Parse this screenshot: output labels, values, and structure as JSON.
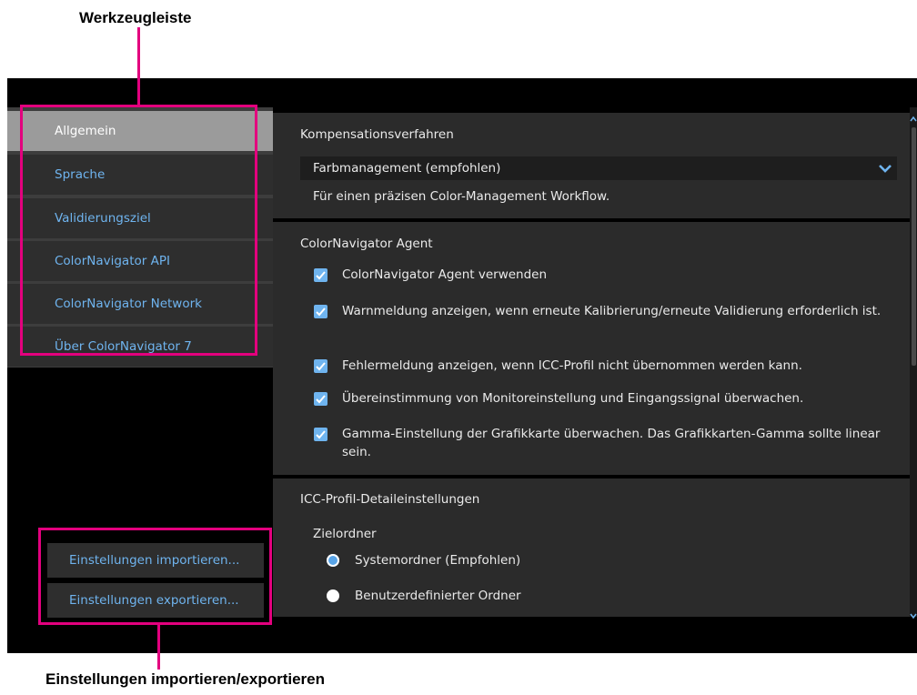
{
  "callouts": {
    "toolbar": "Werkzeugleiste",
    "import_export": "Einstellungen importieren/exportieren"
  },
  "sidebar": {
    "items": [
      {
        "label": "Allgemein",
        "active": true
      },
      {
        "label": "Sprache"
      },
      {
        "label": "Validierungsziel"
      },
      {
        "label": "ColorNavigator API"
      },
      {
        "label": "ColorNavigator Network"
      },
      {
        "label": "Über ColorNavigator 7"
      }
    ],
    "import_label": "Einstellungen importieren...",
    "export_label": "Einstellungen exportieren..."
  },
  "compensation": {
    "title": "Kompensationsverfahren",
    "selected": "Farbmanagement (empfohlen)",
    "description": "Für einen präzisen Color-Management Workflow."
  },
  "agent": {
    "title": "ColorNavigator Agent",
    "options": [
      {
        "label": "ColorNavigator Agent verwenden",
        "checked": true
      },
      {
        "label": "Warnmeldung anzeigen, wenn erneute Kalibrierung/erneute Validierung erforderlich ist.",
        "checked": true
      },
      {
        "label": "Fehlermeldung anzeigen, wenn ICC-Profil nicht übernommen werden kann.",
        "checked": true
      },
      {
        "label": "Übereinstimmung von Monitoreinstellung und Eingangssignal überwachen.",
        "checked": true
      },
      {
        "label": "Gamma-Einstellung der Grafikkarte überwachen. Das Grafikkarten-Gamma sollte linear sein.",
        "checked": true
      }
    ]
  },
  "icc": {
    "title": "ICC-Profil-Detaileinstellungen",
    "folder_label": "Zielordner",
    "options": [
      {
        "label": "Systemordner (Empfohlen)",
        "selected": true
      },
      {
        "label": "Benutzerdefinierter Ordner",
        "selected": false
      }
    ]
  },
  "colors": {
    "accent": "#6fb4ef",
    "highlight": "#e3007e",
    "panel": "#2b2b2b",
    "active_nav": "#9b9b9b"
  }
}
